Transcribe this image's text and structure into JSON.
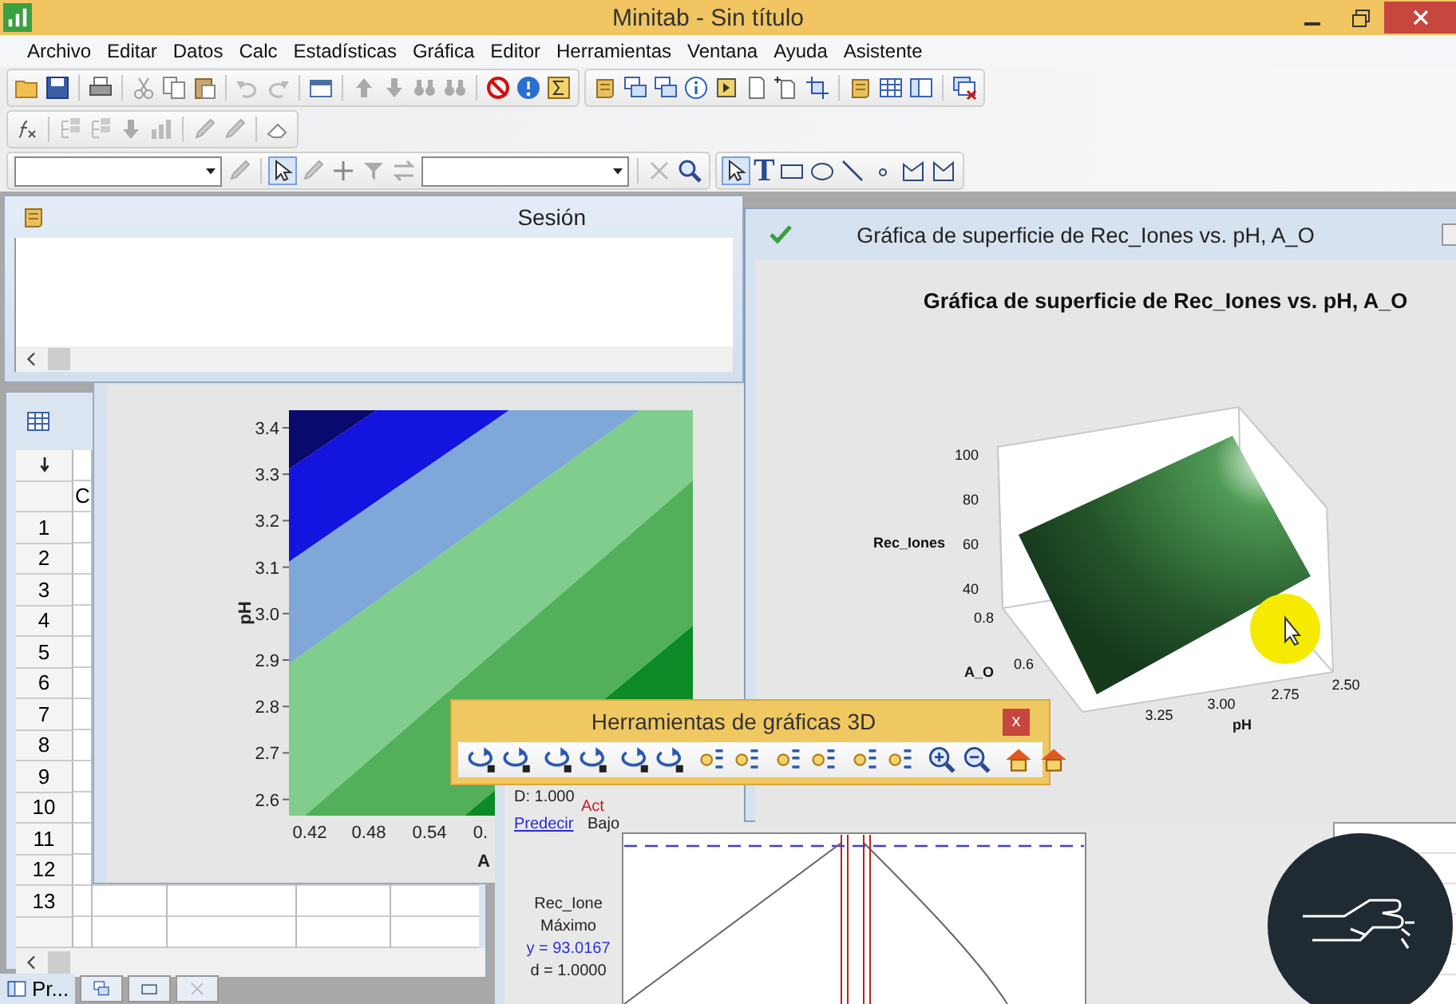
{
  "window": {
    "title": "Minitab - Sin título"
  },
  "menu": [
    {
      "label": "Archivo"
    },
    {
      "label": "Editar"
    },
    {
      "label": "Datos"
    },
    {
      "label": "Calc"
    },
    {
      "label": "Estadísticas"
    },
    {
      "label": "Gráfica"
    },
    {
      "label": "Editor"
    },
    {
      "label": "Herramientas"
    },
    {
      "label": "Ventana"
    },
    {
      "label": "Ayuda"
    },
    {
      "label": "Asistente"
    }
  ],
  "toolbar": {
    "text_tool": "T"
  },
  "session": {
    "title": "Sesión"
  },
  "worksheet": {
    "column_header": "C",
    "rows": [
      "1",
      "2",
      "3",
      "4",
      "5",
      "6",
      "7",
      "8",
      "9",
      "10",
      "11",
      "12",
      "13"
    ]
  },
  "contour_graph": {
    "ylabel": "pH",
    "yticks": [
      "3.4",
      "3.3",
      "3.2",
      "3.1",
      "3.0",
      "2.9",
      "2.8",
      "2.7",
      "2.6"
    ],
    "xticks": [
      "0.42",
      "0.48",
      "0.54",
      "0."
    ],
    "xlabel": "A"
  },
  "surface_graph": {
    "window_title": "Gráfica de superficie de Rec_Iones vs. pH, A_O",
    "title": "Gráfica de superficie de Rec_Iones vs. pH, A_O",
    "zlabel": "Rec_Iones",
    "zticks": [
      "100",
      "80",
      "60",
      "40"
    ],
    "a_label": "A_O",
    "a_ticks": [
      "0.8",
      "0.6"
    ],
    "ph_label": "pH",
    "ph_ticks": [
      "3.25",
      "3.00",
      "2.75",
      "2.50"
    ]
  },
  "tools_3d": {
    "title": "Herramientas de gráficas 3D",
    "close": "x"
  },
  "optimizer": {
    "d_value": "D: 1.000",
    "status": "Act",
    "predict_link": "Predecir",
    "setting": "Bajo",
    "response": "Rec_Ione",
    "goal": "Máximo",
    "y_value": "y = 93.0167",
    "d_individual": "d = 1.0000"
  },
  "taskbar": {
    "minimized_window": "Pr..."
  }
}
